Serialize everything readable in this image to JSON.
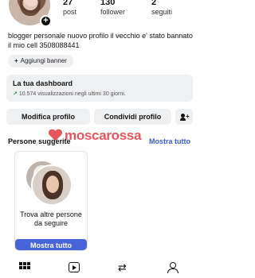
{
  "profile": {
    "stats": [
      {
        "value": "27",
        "label": "post"
      },
      {
        "value": "130",
        "label": "follower"
      },
      {
        "value": "2",
        "label": "seguiti"
      }
    ],
    "bio": "blogger personale nuovo profilo il vecchio e' stato bannato il mio cell 3508088441"
  },
  "banner": {
    "label": "Aggiungi banner"
  },
  "dashboard": {
    "title": "La tua dashboard",
    "subtitle": "10.574 visualizzazioni negli ultimi 30 giorni."
  },
  "actions": {
    "edit_label": "Modifica profilo",
    "share_label": "Condividi profilo"
  },
  "suggestions": {
    "title": "Persone suggerite",
    "show_all": "Mostra tutto",
    "card_text": "Trova altre persone da seguire",
    "card_button": "Mostra tutto"
  },
  "watermark": {
    "text": "moscarossa"
  },
  "colors": {
    "accent": "#4763d8",
    "link": "#3c5ad6",
    "watermark": "#e5565e"
  },
  "icons": {
    "nav": [
      "grid-icon",
      "reels-icon",
      "repost-icon",
      "profile-icon"
    ]
  }
}
